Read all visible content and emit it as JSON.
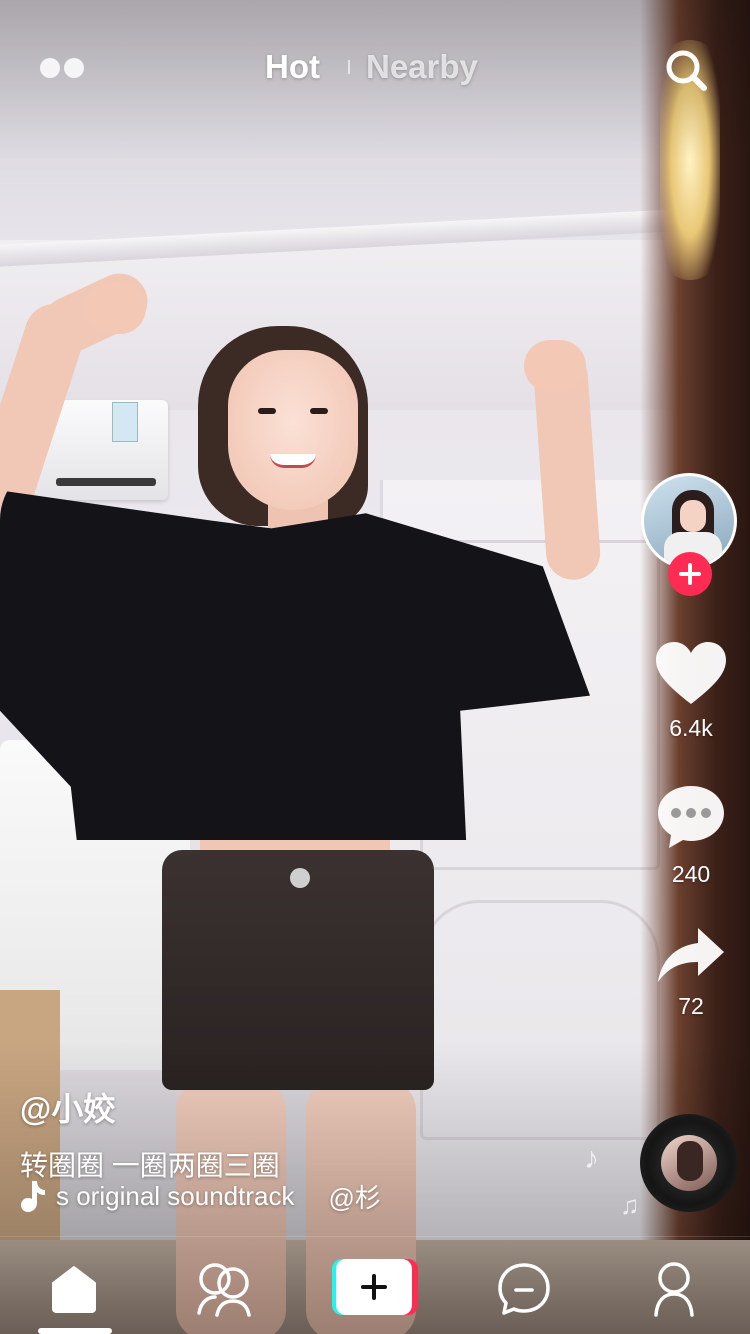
{
  "header": {
    "tabs": [
      {
        "label": "Hot",
        "active": true
      },
      {
        "label": "Nearby",
        "active": false
      }
    ],
    "live_icon": "live-dots-icon",
    "search_icon": "search-icon"
  },
  "creator": {
    "username": "@小姣",
    "follow_icon": "plus-icon"
  },
  "actions": {
    "likes": "6.4k",
    "comments": "240",
    "shares": "72"
  },
  "caption": {
    "description": "转圈圈 一圈两圈三圈"
  },
  "music": {
    "title": "s original soundtrack",
    "title_next": "@杉"
  },
  "bottom_nav": {
    "items": [
      {
        "icon": "home-icon",
        "active": true
      },
      {
        "icon": "friends-icon",
        "active": false
      },
      {
        "icon": "create-plus-icon",
        "active": false
      },
      {
        "icon": "message-icon",
        "active": false
      },
      {
        "icon": "profile-icon",
        "active": false
      }
    ]
  },
  "colors": {
    "accent_red": "#fe2c55",
    "accent_cyan": "#25f4ee",
    "text": "#ffffff"
  }
}
